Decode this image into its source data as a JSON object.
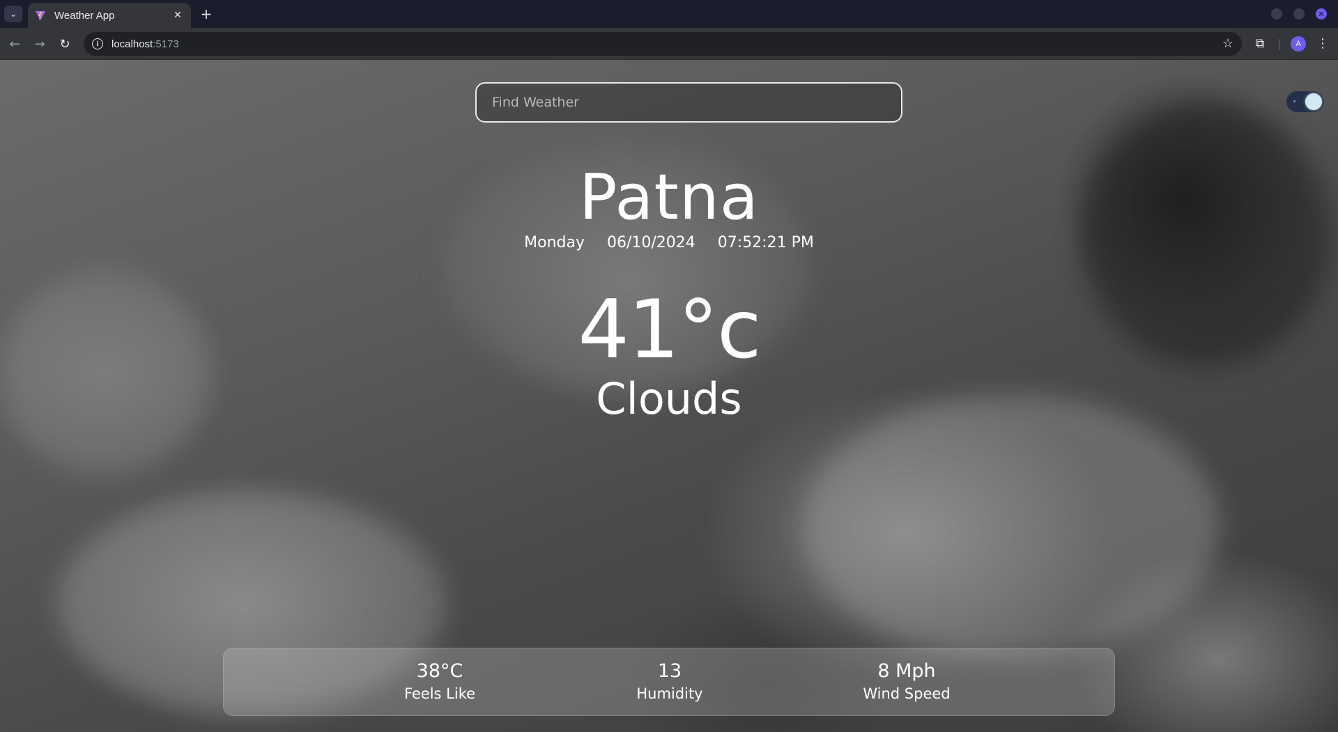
{
  "browser": {
    "tab": {
      "title": "Weather App",
      "close_icon": "close-icon"
    },
    "new_tab_icon": "plus-icon",
    "address": {
      "host": "localhost",
      "port": ":5173"
    },
    "avatar_initial": "A"
  },
  "search": {
    "placeholder": "Find Weather",
    "value": ""
  },
  "theme_toggle": {
    "mode": "dark"
  },
  "weather": {
    "city": "Patna",
    "day": "Monday",
    "date": "06/10/2024",
    "time": "07:52:21 PM",
    "temperature": "41°c",
    "condition": "Clouds"
  },
  "stats": {
    "feels_like": {
      "value": "38°C",
      "label": "Feels Like"
    },
    "humidity": {
      "value": "13",
      "label": "Humidity"
    },
    "wind": {
      "value": "8 Mph",
      "label": "Wind Speed"
    }
  },
  "colors": {
    "tabbar_bg": "#1b1c2c",
    "toolbar_bg": "#35363a",
    "accent": "#6e5cf2",
    "text": "#ffffff"
  }
}
